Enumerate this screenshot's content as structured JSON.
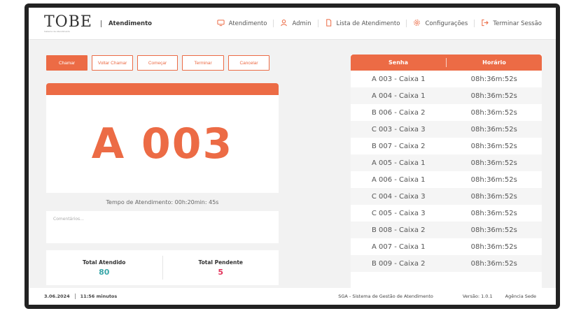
{
  "header": {
    "logo": "TOBE",
    "logo_sub": "Sistema de Atendimento",
    "title": "Atendimento",
    "nav": [
      {
        "label": "Atendimento",
        "icon": "monitor-icon"
      },
      {
        "label": "Admin",
        "icon": "user-icon"
      },
      {
        "label": "Lista de Atendimento",
        "icon": "document-icon"
      },
      {
        "label": "Configurações",
        "icon": "gear-icon"
      },
      {
        "label": "Terminar Sessão",
        "icon": "logout-icon"
      }
    ]
  },
  "actions": {
    "call": "Chamar",
    "recall": "Voltar Chamar",
    "start": "Começar",
    "finish": "Terminar",
    "cancel": "Cancelar"
  },
  "current": {
    "ticket": "A 003",
    "timer": "Tempo de Atendimento: 00h:20min: 45s"
  },
  "comments": {
    "placeholder": "Comentários..."
  },
  "totals": {
    "attended_label": "Total Atendido",
    "attended_value": "80",
    "pending_label": "Total Pendente",
    "pending_value": "5"
  },
  "queue": {
    "columns": [
      "Senha",
      "Horário"
    ],
    "rows": [
      [
        "A 003 - Caixa 1",
        "08h:36m:52s"
      ],
      [
        "A 004 - Caixa 1",
        "08h:36m:52s"
      ],
      [
        "B 006 - Caixa 2",
        "08h:36m:52s"
      ],
      [
        "C 003 - Caixa 3",
        "08h:36m:52s"
      ],
      [
        "B 007 - Caixa 2",
        "08h:36m:52s"
      ],
      [
        "A 005 - Caixa 1",
        "08h:36m:52s"
      ],
      [
        "A 006 - Caixa 1",
        "08h:36m:52s"
      ],
      [
        "C 004 - Caixa 3",
        "08h:36m:52s"
      ],
      [
        "C 005 - Caixa 3",
        "08h:36m:52s"
      ],
      [
        "B 008 - Caixa 2",
        "08h:36m:52s"
      ],
      [
        "A 007 - Caixa 1",
        "08h:36m:52s"
      ],
      [
        "B 009 - Caixa 2",
        "08h:36m:52s"
      ]
    ]
  },
  "footer": {
    "date": "3.06.2024",
    "time": "11:56 minutos",
    "system": "SGA - Sistema de Gestão de Atendimento",
    "version": "Versão: 1.0.1",
    "agency": "Agência Sede"
  },
  "colors": {
    "accent": "#ec6b45",
    "attended": "#3aa7a9",
    "pending": "#e2335b"
  }
}
